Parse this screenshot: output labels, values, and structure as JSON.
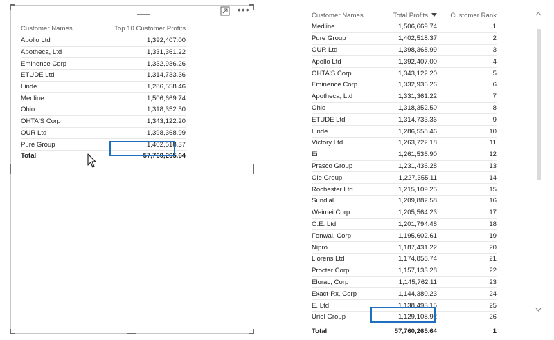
{
  "left_visual": {
    "headers": [
      "Customer Names",
      "Top 10 Customer Profits"
    ],
    "rows": [
      [
        "Apollo Ltd",
        "1,392,407.00"
      ],
      [
        "Apotheca, Ltd",
        "1,331,361.22"
      ],
      [
        "Eminence Corp",
        "1,332,936.26"
      ],
      [
        "ETUDE Ltd",
        "1,314,733.36"
      ],
      [
        "Linde",
        "1,286,558.46"
      ],
      [
        "Medline",
        "1,506,669.74"
      ],
      [
        "Ohio",
        "1,318,352.50"
      ],
      [
        "OHTA'S Corp",
        "1,343,122.20"
      ],
      [
        "OUR Ltd",
        "1,398,368.99"
      ],
      [
        "Pure Group",
        "1,402,518.37"
      ]
    ],
    "total_label": "Total",
    "total_value": "57,760,265.64",
    "icons": [
      "drag-grip-icon",
      "focus-mode-icon",
      "more-options-icon"
    ]
  },
  "right_visual": {
    "headers": [
      "Customer Names",
      "Total Profits",
      "Customer Rank"
    ],
    "sorted_column": "Total Profits",
    "rows": [
      [
        "Medline",
        "1,506,669.74",
        "1"
      ],
      [
        "Pure Group",
        "1,402,518.37",
        "2"
      ],
      [
        "OUR Ltd",
        "1,398,368.99",
        "3"
      ],
      [
        "Apollo Ltd",
        "1,392,407.00",
        "4"
      ],
      [
        "OHTA'S Corp",
        "1,343,122.20",
        "5"
      ],
      [
        "Eminence Corp",
        "1,332,936.26",
        "6"
      ],
      [
        "Apotheca, Ltd",
        "1,331,361.22",
        "7"
      ],
      [
        "Ohio",
        "1,318,352.50",
        "8"
      ],
      [
        "ETUDE Ltd",
        "1,314,733.36",
        "9"
      ],
      [
        "Linde",
        "1,286,558.46",
        "10"
      ],
      [
        "Victory Ltd",
        "1,263,722.18",
        "11"
      ],
      [
        "Ei",
        "1,261,536.90",
        "12"
      ],
      [
        "Prasco Group",
        "1,231,436.28",
        "13"
      ],
      [
        "Ole Group",
        "1,227,355.11",
        "14"
      ],
      [
        "Rochester Ltd",
        "1,215,109.25",
        "15"
      ],
      [
        "Sundial",
        "1,209,882.58",
        "16"
      ],
      [
        "Weimei Corp",
        "1,205,564.23",
        "17"
      ],
      [
        "O.E. Ltd",
        "1,201,794.48",
        "18"
      ],
      [
        "Fenwal, Corp",
        "1,195,602.61",
        "19"
      ],
      [
        "Nipro",
        "1,187,431.22",
        "20"
      ],
      [
        "Llorens Ltd",
        "1,174,858.74",
        "21"
      ],
      [
        "Procter Corp",
        "1,157,133.28",
        "22"
      ],
      [
        "Elorac, Corp",
        "1,145,762.11",
        "23"
      ],
      [
        "Exact-Rx, Corp",
        "1,144,380.23",
        "24"
      ],
      [
        "E. Ltd",
        "1,138,493.15",
        "25"
      ],
      [
        "Uriel Group",
        "1,129,108.92",
        "26"
      ]
    ],
    "total_label": "Total",
    "total_value": "57,760,265.64",
    "total_rank": "1",
    "icons": [
      "sort-descending-icon",
      "scroll-up-icon",
      "scroll-down-icon"
    ]
  },
  "colors": {
    "highlight": "#1f6fbf",
    "header_text": "#605e5c",
    "row_divider": "#e8e8e8"
  }
}
